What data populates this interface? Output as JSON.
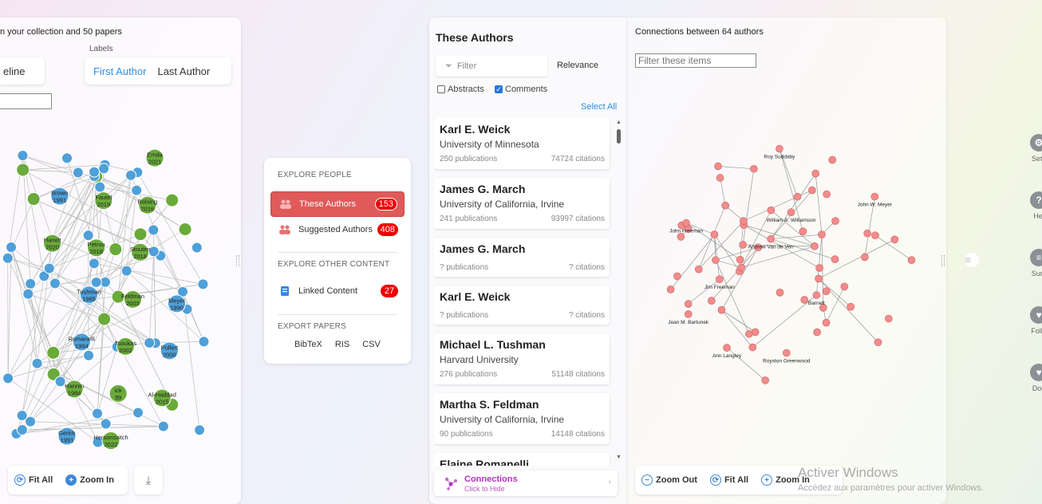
{
  "left_panel": {
    "header": "n your collection and 50 papers",
    "labels_caption": "Labels",
    "timeline_button": "eline",
    "first_author": "First Author",
    "last_author": "Last Author",
    "nodes": [
      {
        "label": "Hanelt\n2020",
        "color": "green"
      },
      {
        "label": "Brown\n1991",
        "color": "blue"
      },
      {
        "label": "Gerick\n1991",
        "color": "blue"
      },
      {
        "label": "Hannin\n1984",
        "color": "green"
      },
      {
        "label": "Romanelli\n1994",
        "color": "blue"
      },
      {
        "label": "Tushman\n1985",
        "color": "blue"
      },
      {
        "label": "Petrou\n2018",
        "color": "green"
      },
      {
        "label": "Fautel\n2019",
        "color": "green"
      },
      {
        "label": "Hersonsvitch\n2022",
        "color": "green"
      },
      {
        "label": "ick\n99",
        "color": "green"
      },
      {
        "label": "Tsoukas\n2002",
        "color": "green"
      },
      {
        "label": "Feldman\n2003",
        "color": "green"
      },
      {
        "label": "Stouten\n2018",
        "color": "green"
      },
      {
        "label": "Bolsing\n2016",
        "color": "green"
      },
      {
        "label": "Emda\n2021",
        "color": "green"
      },
      {
        "label": "Al-Haddad\n2015",
        "color": "green"
      },
      {
        "label": "Pollert\n2000",
        "color": "blue"
      },
      {
        "label": "Meyer\n1990",
        "color": "blue"
      }
    ],
    "tools": {
      "fit_all": "Fit All",
      "zoom_in": "Zoom In"
    }
  },
  "explore_menu": {
    "explore_people": "EXPLORE PEOPLE",
    "these_authors": "These Authors",
    "these_authors_count": "153",
    "suggested_authors": "Suggested Authors",
    "suggested_authors_count": "408",
    "explore_other": "EXPLORE OTHER CONTENT",
    "linked_content": "Linked Content",
    "linked_content_count": "27",
    "export_papers": "EXPORT PAPERS",
    "export": [
      "BibTeX",
      "RIS",
      "CSV"
    ]
  },
  "authors_panel": {
    "title": "These Authors",
    "filter_placeholder": "Filter",
    "sort": "Relevance",
    "abstracts": "Abstracts",
    "comments": "Comments",
    "select_all": "Select All",
    "authors": [
      {
        "name": "Karl E. Weick",
        "affiliation": "University of Minnesota",
        "publications": "250 publications",
        "citations": "74724 citations"
      },
      {
        "name": "James G. March",
        "affiliation": "University of California, Irvine",
        "publications": "241 publications",
        "citations": "93997 citations"
      },
      {
        "name": "James G. March",
        "affiliation": "",
        "publications": "? publications",
        "citations": "? citations"
      },
      {
        "name": "Karl E. Weick",
        "affiliation": "",
        "publications": "? publications",
        "citations": "? citations"
      },
      {
        "name": "Michael L. Tushman",
        "affiliation": "Harvard University",
        "publications": "276 publications",
        "citations": "51148 citations"
      },
      {
        "name": "Martha S. Feldman",
        "affiliation": "University of California, Irvine",
        "publications": "90 publications",
        "citations": "14148 citations"
      },
      {
        "name": "Elaine Romanelli",
        "affiliation": "",
        "publications": "",
        "citations": ""
      }
    ],
    "connections_title": "Connections",
    "connections_sub": "Click to Hide"
  },
  "right_panel": {
    "title": "Connections between 64 authors",
    "filter_placeholder": "Filter these items",
    "nodes": [
      "John W. Meyer",
      "Roy Suddaby",
      "Andrew Van de Ven",
      "Ann Langley",
      "Jean M. Bartunek",
      "John Freeman",
      "Jim Freeman",
      "William A. Williamson",
      "Barnett",
      "Royston Greenwood"
    ],
    "tools": {
      "zoom_out": "Zoom Out",
      "fit_all": "Fit All",
      "zoom_in": "Zoom In"
    }
  },
  "sidebar": {
    "items": [
      {
        "label": "Setti",
        "icon": "gear-icon"
      },
      {
        "label": "Hel",
        "icon": "help-icon"
      },
      {
        "label": "Surv",
        "icon": "survey-icon"
      },
      {
        "label": "Follo",
        "icon": "heart-icon"
      },
      {
        "label": "Don",
        "icon": "donate-icon"
      }
    ]
  },
  "watermark": {
    "line1": "Activer Windows",
    "line2": "Accédez aux paramètres pour activer Windows."
  },
  "colors": {
    "accent_blue": "#2f8fe0",
    "active_red": "#e05a5a",
    "badge_red": "#ee0000",
    "connections_purple": "#b233c0",
    "node_blue": "#4f9fd8",
    "node_green": "#6aaa3a",
    "node_pink": "#f08c8c"
  }
}
